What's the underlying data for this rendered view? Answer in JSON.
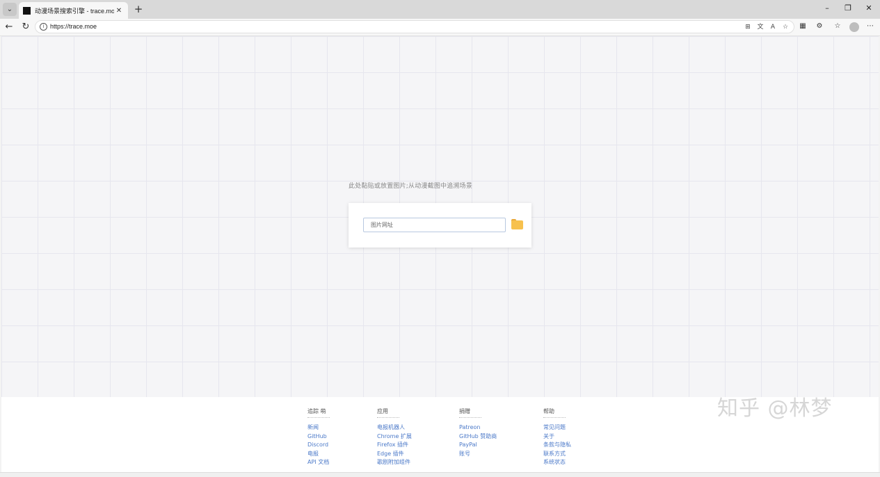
{
  "browser": {
    "tab_title": "动漫场景搜索引擎 - trace.moe",
    "url": "https://trace.moe",
    "window_controls": {
      "minimize": "–",
      "maximize": "❐",
      "close": "✕"
    }
  },
  "main": {
    "prompt": "此处黏贴或放置图片;从动漫截图中追溯场景",
    "url_placeholder": "图片网址"
  },
  "footer": {
    "columns": [
      {
        "title": "追踪 萌",
        "links": [
          "新闻",
          "GitHub",
          "Discord",
          "电报",
          "API 文档"
        ]
      },
      {
        "title": "应用",
        "links": [
          "电报机器人",
          "Chrome 扩展",
          "Firefox 插件",
          "Edge 插件",
          "歌剧附加组件"
        ]
      },
      {
        "title": "捐赠",
        "links": [
          "Patreon",
          "GitHub 赞助商",
          "PayPal",
          "账号"
        ]
      },
      {
        "title": "帮助",
        "links": [
          "常见问题",
          "关于",
          "条款与隐私",
          "联系方式",
          "系统状态"
        ]
      }
    ]
  },
  "watermark": "知乎 @林梦",
  "colors": {
    "link": "#4a78c8",
    "folder": "#f7c14e",
    "page_bg": "#f5f5f7"
  }
}
